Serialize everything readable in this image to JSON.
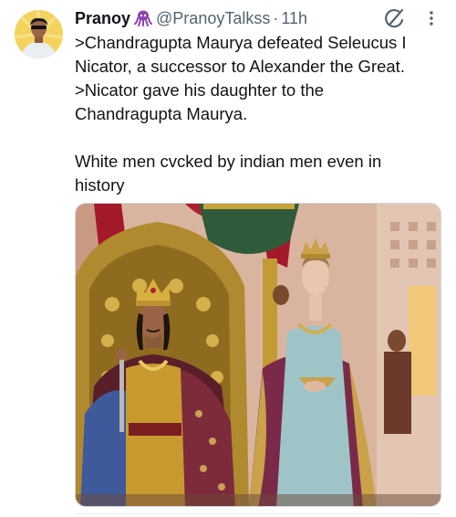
{
  "tweet": {
    "display_name": "Pranoy",
    "handle": "@PranoyTalkss",
    "separator": "·",
    "time": "11h",
    "badge_icon": "purple-octopus-emoji",
    "text": ">Chandragupta Maurya defeated Seleucus I\nNicator, a successor to Alexander the Great.\n>Nicator gave his daughter to the\nChandragupta Maurya.\n\nWhite men cvcked by indian men even in\nhistory",
    "image_alt": "Costumed actors portraying a crowned king on a golden throne and a queen in a blue gown"
  },
  "colors": {
    "text": "#0f1419",
    "secondary": "#536471",
    "avatar_bg": "#f3d35e",
    "badge": "#8e44ad"
  }
}
